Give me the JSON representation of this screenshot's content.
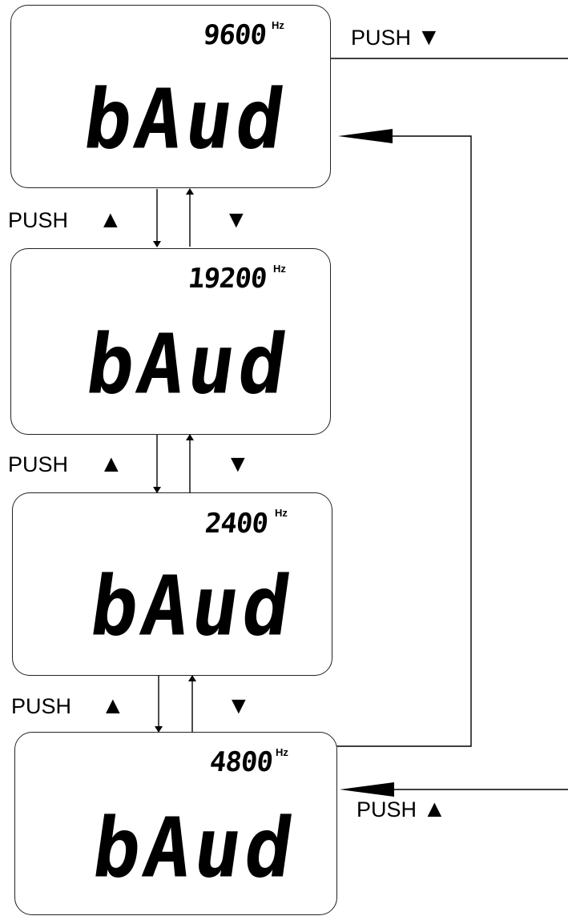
{
  "displays": [
    {
      "frequency": "9600",
      "unit": "Hz",
      "mode": "bAud"
    },
    {
      "frequency": "19200",
      "unit": "Hz",
      "mode": "bAud"
    },
    {
      "frequency": "2400",
      "unit": "Hz",
      "mode": "bAud"
    },
    {
      "frequency": "4800",
      "unit": "Hz",
      "mode": "bAud"
    }
  ],
  "labels": {
    "push": "PUSH",
    "up_symbol": "▲",
    "down_symbol": "▼"
  },
  "icons": {
    "up": "up-triangle-icon",
    "down": "down-triangle-icon"
  },
  "colors": {
    "ink": "#000000",
    "background": "#ffffff"
  }
}
